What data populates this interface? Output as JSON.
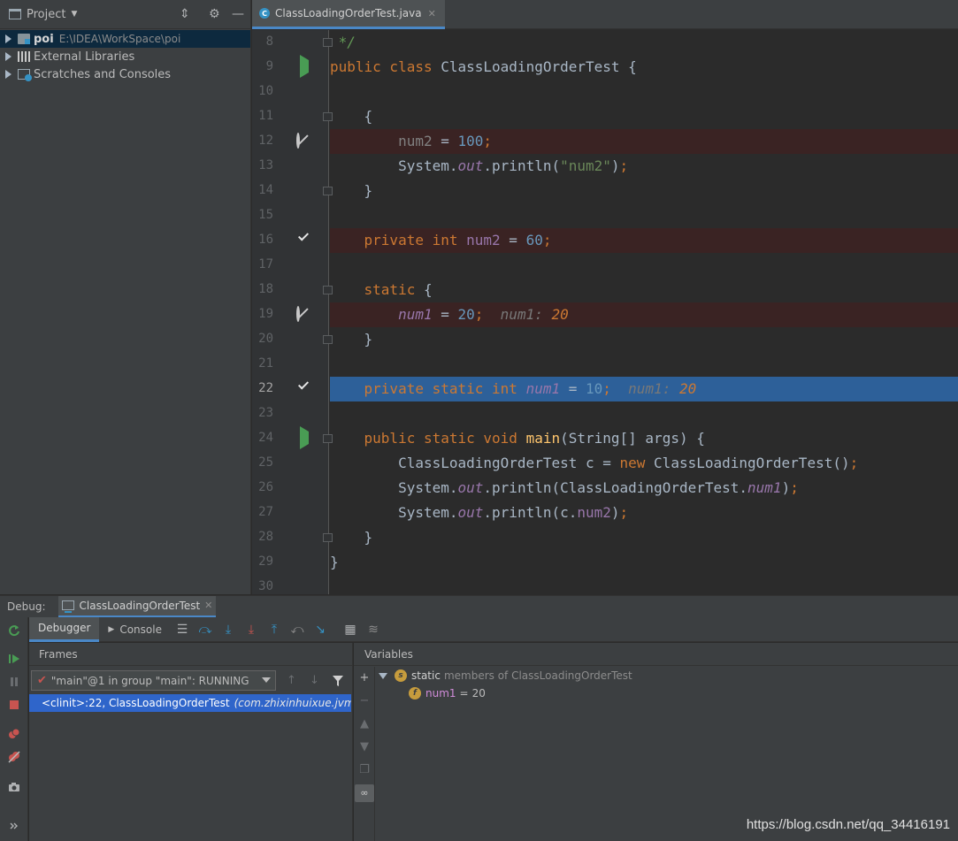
{
  "project": {
    "title": "Project",
    "tree": [
      {
        "label": "poi",
        "path": "E:\\IDEA\\WorkSpace\\poi",
        "icon": "module-folder-icon"
      },
      {
        "label": "External Libraries",
        "icon": "library-icon"
      },
      {
        "label": "Scratches and Consoles",
        "icon": "scratches-icon"
      }
    ]
  },
  "editor": {
    "tab_label": "ClassLoadingOrderTest.java",
    "lines": [
      {
        "num": "8",
        "gutter": "",
        "fold": true,
        "kind": "normal",
        "tokens": [
          [
            "cmt",
            " */"
          ]
        ]
      },
      {
        "num": "9",
        "gutter": "run",
        "fold": false,
        "kind": "normal",
        "tokens": [
          [
            "kw",
            "public class "
          ],
          [
            "plain",
            "ClassLoadingOrderTest {"
          ]
        ]
      },
      {
        "num": "10",
        "gutter": "",
        "fold": false,
        "kind": "normal",
        "tokens": []
      },
      {
        "num": "11",
        "gutter": "",
        "fold": true,
        "kind": "normal",
        "tokens": [
          [
            "plain",
            "    {"
          ]
        ]
      },
      {
        "num": "12",
        "gutter": "nobp",
        "fold": false,
        "kind": "bp",
        "tokens": [
          [
            "plain",
            "        "
          ],
          [
            "dim",
            "num2"
          ],
          [
            "plain",
            " = "
          ],
          [
            "num",
            "100"
          ],
          [
            "kw",
            ";"
          ]
        ]
      },
      {
        "num": "13",
        "gutter": "",
        "fold": false,
        "kind": "normal",
        "tokens": [
          [
            "plain",
            "        System."
          ],
          [
            "sout",
            "out"
          ],
          [
            "plain",
            ".println("
          ],
          [
            "str",
            "\"num2\""
          ],
          [
            "plain",
            ")"
          ],
          [
            "kw",
            ";"
          ]
        ]
      },
      {
        "num": "14",
        "gutter": "",
        "fold": true,
        "kind": "normal",
        "tokens": [
          [
            "plain",
            "    }"
          ]
        ]
      },
      {
        "num": "15",
        "gutter": "",
        "fold": false,
        "kind": "normal",
        "tokens": []
      },
      {
        "num": "16",
        "gutter": "bpcheck",
        "fold": false,
        "kind": "bp",
        "tokens": [
          [
            "plain",
            "    "
          ],
          [
            "kw",
            "private int "
          ],
          [
            "field",
            "num2"
          ],
          [
            "plain",
            " = "
          ],
          [
            "num",
            "60"
          ],
          [
            "kw",
            ";"
          ]
        ]
      },
      {
        "num": "17",
        "gutter": "",
        "fold": false,
        "kind": "normal",
        "tokens": []
      },
      {
        "num": "18",
        "gutter": "",
        "fold": true,
        "kind": "normal",
        "tokens": [
          [
            "plain",
            "    "
          ],
          [
            "kw",
            "static "
          ],
          [
            "plain",
            "{"
          ]
        ]
      },
      {
        "num": "19",
        "gutter": "nobp",
        "fold": false,
        "kind": "bp",
        "tokens": [
          [
            "plain",
            "        "
          ],
          [
            "sfield",
            "num1"
          ],
          [
            "plain",
            " = "
          ],
          [
            "num",
            "20"
          ],
          [
            "kw",
            ";"
          ],
          [
            "plain",
            "  "
          ],
          [
            "hint",
            "num1: "
          ],
          [
            "hintval",
            "20"
          ]
        ]
      },
      {
        "num": "20",
        "gutter": "",
        "fold": true,
        "kind": "normal",
        "tokens": [
          [
            "plain",
            "    }"
          ]
        ]
      },
      {
        "num": "21",
        "gutter": "",
        "fold": false,
        "kind": "normal",
        "tokens": []
      },
      {
        "num": "22",
        "gutter": "bpcheck",
        "fold": false,
        "kind": "exec",
        "tokens": [
          [
            "plain",
            "    "
          ],
          [
            "kw",
            "private static int "
          ],
          [
            "sfield",
            "num1"
          ],
          [
            "plain",
            " = "
          ],
          [
            "num",
            "10"
          ],
          [
            "kw",
            ";"
          ],
          [
            "plain",
            "  "
          ],
          [
            "hint",
            "num1: "
          ],
          [
            "hintval",
            "20"
          ]
        ]
      },
      {
        "num": "23",
        "gutter": "",
        "fold": false,
        "kind": "normal",
        "tokens": []
      },
      {
        "num": "24",
        "gutter": "run",
        "fold": true,
        "kind": "normal",
        "tokens": [
          [
            "plain",
            "    "
          ],
          [
            "kw",
            "public static void "
          ],
          [
            "method",
            "main"
          ],
          [
            "plain",
            "(String[] args) {"
          ]
        ]
      },
      {
        "num": "25",
        "gutter": "",
        "fold": false,
        "kind": "normal",
        "tokens": [
          [
            "plain",
            "        ClassLoadingOrderTest c = "
          ],
          [
            "kw",
            "new "
          ],
          [
            "plain",
            "ClassLoadingOrderTest()"
          ],
          [
            "kw",
            ";"
          ]
        ]
      },
      {
        "num": "26",
        "gutter": "",
        "fold": false,
        "kind": "normal",
        "tokens": [
          [
            "plain",
            "        System."
          ],
          [
            "sout",
            "out"
          ],
          [
            "plain",
            ".println(ClassLoadingOrderTest."
          ],
          [
            "sfield",
            "num1"
          ],
          [
            "plain",
            ")"
          ],
          [
            "kw",
            ";"
          ]
        ]
      },
      {
        "num": "27",
        "gutter": "",
        "fold": false,
        "kind": "normal",
        "tokens": [
          [
            "plain",
            "        System."
          ],
          [
            "sout",
            "out"
          ],
          [
            "plain",
            ".println(c."
          ],
          [
            "field",
            "num2"
          ],
          [
            "plain",
            ")"
          ],
          [
            "kw",
            ";"
          ]
        ]
      },
      {
        "num": "28",
        "gutter": "",
        "fold": true,
        "kind": "normal",
        "tokens": [
          [
            "plain",
            "    }"
          ]
        ]
      },
      {
        "num": "29",
        "gutter": "",
        "fold": false,
        "kind": "normal",
        "tokens": [
          [
            "plain",
            "}"
          ]
        ]
      },
      {
        "num": "30",
        "gutter": "",
        "fold": false,
        "kind": "normal",
        "tokens": []
      }
    ]
  },
  "debug": {
    "label": "Debug:",
    "session_tab": "ClassLoadingOrderTest",
    "tabs": {
      "debugger": "Debugger",
      "console": "Console"
    },
    "frames": {
      "title": "Frames",
      "thread": "\"main\"@1 in group \"main\": RUNNING",
      "frame_main": "<clinit>:22, ClassLoadingOrderTest",
      "frame_pkg": "(com.zhixinhuixue.jvm)"
    },
    "variables": {
      "title": "Variables",
      "static_label": "static",
      "static_desc": "members of ClassLoadingOrderTest",
      "var_name": "num1",
      "var_eq": "=",
      "var_value": "20"
    }
  },
  "watermark": "https://blog.csdn.net/qq_34416191"
}
